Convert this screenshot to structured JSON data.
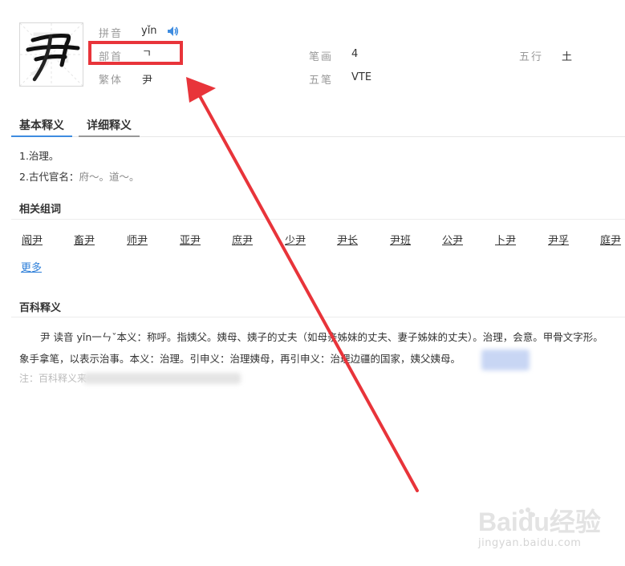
{
  "character": {
    "glyph": "尹",
    "pinyin_label": "拼音",
    "pinyin_value": "yǐn",
    "radical_label": "部首",
    "radical_value": "ㄱ",
    "traditional_label": "繁体",
    "traditional_value": "尹",
    "strokes_label": "笔画",
    "strokes_value": "4",
    "wubi_label": "五笔",
    "wubi_value": "VTE",
    "wuxing_label": "五行",
    "wuxing_value": "土"
  },
  "tabs": [
    "基本释义",
    "详细释义"
  ],
  "basic_definitions": {
    "line1": "1.治理。",
    "line2_prefix": "2.古代官名：",
    "line2_examples": "府～。道～。"
  },
  "related_words": {
    "title": "相关组词",
    "words": [
      "阍尹",
      "畜尹",
      "师尹",
      "亚尹",
      "庶尹",
      "少尹",
      "尹长",
      "尹班",
      "公尹",
      "卜尹",
      "尹孚",
      "庭尹"
    ],
    "more": "更多"
  },
  "encyclopedia": {
    "title": "百科释义",
    "line1": "尹 读音 yǐn一ㄣˇ本义：称呼。指姨父。姨母、姨子的丈夫（如母亲姊妹的丈夫、妻子姊妹的丈夫）。治理，会意。甲骨文字形。",
    "line2": "象手拿笔，以表示治事。本义：治理。引申义：治理姨母，再引申义：治理边疆的国家，姨父姨母。",
    "note": "注：百科释义来"
  },
  "watermark": {
    "logo_text": "Baidu经验",
    "url": "jingyan.baidu.com"
  },
  "colors": {
    "highlight": "#e8343a",
    "arrow": "#e8343a",
    "tab_active": "#3e8ce0",
    "link": "#2e7fd9",
    "speaker": "#3e8ce0"
  }
}
